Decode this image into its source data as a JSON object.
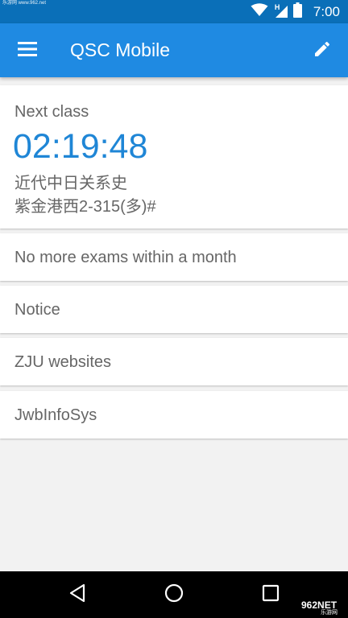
{
  "status_bar": {
    "watermark": "乐游网 www.962.net",
    "time": "7:00",
    "network_label": "H",
    "icons": [
      "wifi-icon",
      "cell-signal-icon",
      "battery-icon"
    ]
  },
  "app_bar": {
    "title": "QSC Mobile",
    "menu_icon": "menu-icon",
    "edit_icon": "pencil-icon"
  },
  "next_class": {
    "label": "Next class",
    "countdown": "02:19:48",
    "course": "近代中日关系史",
    "location": "紫金港西2-315(多)#"
  },
  "cards": {
    "exams": "No more exams within a month",
    "notice": "Notice",
    "websites": "ZJU websites",
    "jwb": "JwbInfoSys"
  },
  "nav_bar": {
    "icons": [
      "back-icon",
      "home-icon",
      "recents-icon"
    ]
  },
  "corner_badge": {
    "text": "962NET",
    "sub": "乐游网"
  },
  "colors": {
    "status_bar": "#0a6fb8",
    "app_bar": "#1f8ae2",
    "countdown": "#1f86d6",
    "background": "#f2f2f2",
    "card_text": "#666666"
  }
}
